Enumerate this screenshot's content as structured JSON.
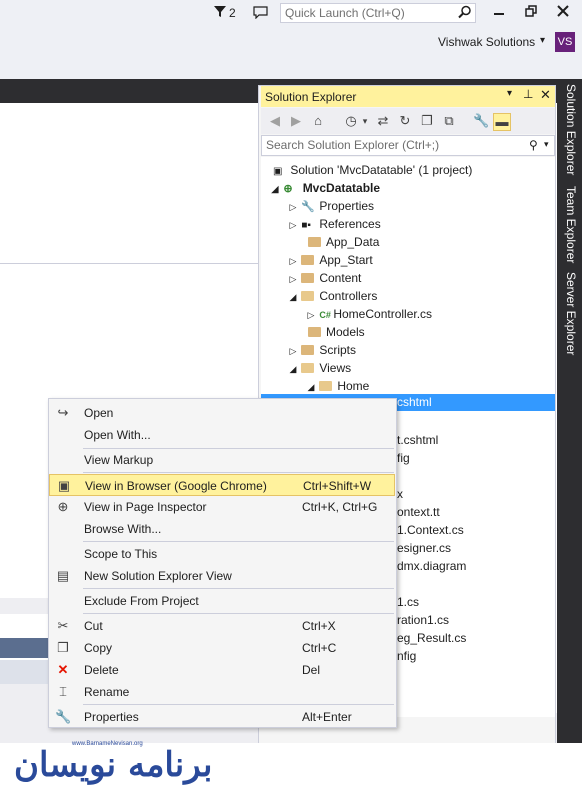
{
  "titlebar": {
    "notification_count": "2",
    "quick_launch_placeholder": "Quick Launch (Ctrl+Q)",
    "account_name": "Vishwak Solutions",
    "account_dropdown_glyph": "▾",
    "avatar_initials": "VS"
  },
  "solution_explorer": {
    "title": "Solution Explorer",
    "search_placeholder": "Search Solution Explorer (Ctrl+;)",
    "tree": {
      "solution": "Solution 'MvcDatatable' (1 project)",
      "project": "MvcDatatable",
      "items": [
        "Properties",
        "References",
        "App_Data",
        "App_Start",
        "Content",
        "Controllers",
        "HomeController.cs",
        "Models",
        "Scripts",
        "Views",
        "Home"
      ],
      "selected_fragment": "cshtml",
      "partial_items": [
        "t.cshtml",
        "fig",
        "x",
        "ontext.tt",
        "1.Context.cs",
        "esigner.cs",
        "dmx.diagram",
        "1.cs",
        "ration1.cs",
        "eg_Result.cs",
        "nfig"
      ]
    }
  },
  "side_tabs": [
    "Solution Explorer",
    "Team Explorer",
    "Server Explorer"
  ],
  "context_menu": {
    "items": [
      {
        "label": "Open",
        "shortcut": "",
        "icon": "open-icon"
      },
      {
        "label": "Open With...",
        "shortcut": "",
        "icon": ""
      },
      {
        "label": "View Markup",
        "shortcut": "",
        "icon": ""
      },
      {
        "label": "View in Browser (Google Chrome)",
        "shortcut": "Ctrl+Shift+W",
        "icon": "browser-icon"
      },
      {
        "label": "View in Page Inspector",
        "shortcut": "Ctrl+K, Ctrl+G",
        "icon": "page-inspector-icon"
      },
      {
        "label": "Browse With...",
        "shortcut": "",
        "icon": ""
      },
      {
        "label": "Scope to This",
        "shortcut": "",
        "icon": ""
      },
      {
        "label": "New Solution Explorer View",
        "shortcut": "",
        "icon": "new-view-icon"
      },
      {
        "label": "Exclude From Project",
        "shortcut": "",
        "icon": ""
      },
      {
        "label": "Cut",
        "shortcut": "Ctrl+X",
        "icon": "scissors-icon"
      },
      {
        "label": "Copy",
        "shortcut": "Ctrl+C",
        "icon": "copy-icon"
      },
      {
        "label": "Delete",
        "shortcut": "Del",
        "icon": "delete-icon"
      },
      {
        "label": "Rename",
        "shortcut": "",
        "icon": "rename-icon"
      },
      {
        "label": "Properties",
        "shortcut": "Alt+Enter",
        "icon": "wrench-icon"
      }
    ]
  },
  "watermark": {
    "url": "www.BarnameNevisan.org",
    "brand": "برنامه نویسان"
  },
  "colors": {
    "accent_highlight": "#fff29d",
    "selection": "#3399ff",
    "dark_chrome": "#2d2d30",
    "avatar_bg": "#68217a",
    "delete_red": "#e51400"
  }
}
